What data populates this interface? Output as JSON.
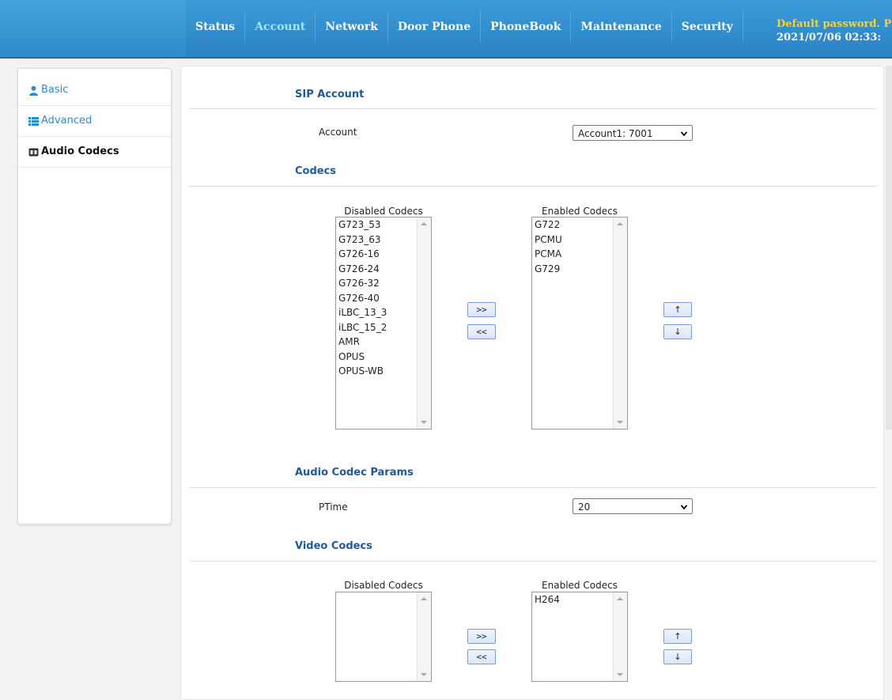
{
  "nav": {
    "items": [
      "Status",
      "Account",
      "Network",
      "Door Phone",
      "PhoneBook",
      "Maintenance",
      "Security"
    ],
    "active": "Account"
  },
  "top_status": {
    "warning": "Default password. P",
    "datetime": "2021/07/06 02:33:"
  },
  "sidebar": {
    "items": [
      {
        "label": "Basic",
        "icon": "user-icon"
      },
      {
        "label": "Advanced",
        "icon": "list-icon"
      },
      {
        "label": "Audio Codecs",
        "icon": "codec-icon"
      }
    ],
    "active": "Audio Codecs"
  },
  "sip_account": {
    "title": "SIP Account",
    "account_label": "Account",
    "account_value": "Account1: 7001"
  },
  "codecs": {
    "title": "Codecs",
    "disabled_caption": "Disabled Codecs",
    "enabled_caption": "Enabled Codecs",
    "disabled": [
      "G723_53",
      "G723_63",
      "G726-16",
      "G726-24",
      "G726-32",
      "G726-40",
      "iLBC_13_3",
      "iLBC_15_2",
      "AMR",
      "OPUS",
      "OPUS-WB"
    ],
    "enabled": [
      "G722",
      "PCMU",
      "PCMA",
      "G729"
    ],
    "move_right": ">>",
    "move_left": "<<",
    "move_up": "↑",
    "move_down": "↓"
  },
  "audio_params": {
    "title": "Audio Codec Params",
    "ptime_label": "PTime",
    "ptime_value": "20"
  },
  "video_codecs": {
    "title": "Video Codecs",
    "disabled_caption": "Disabled Codecs",
    "enabled_caption": "Enabled Codecs",
    "disabled": [],
    "enabled": [
      "H264"
    ],
    "move_right": ">>",
    "move_left": "<<",
    "move_up": "↑",
    "move_down": "↓"
  },
  "colors": {
    "topbar": "#2f8bca",
    "nav_active": "#9fe8ff",
    "warning": "#ffd21f",
    "section_title": "#1f5a99",
    "sidebar_link": "#2f8bd0"
  }
}
